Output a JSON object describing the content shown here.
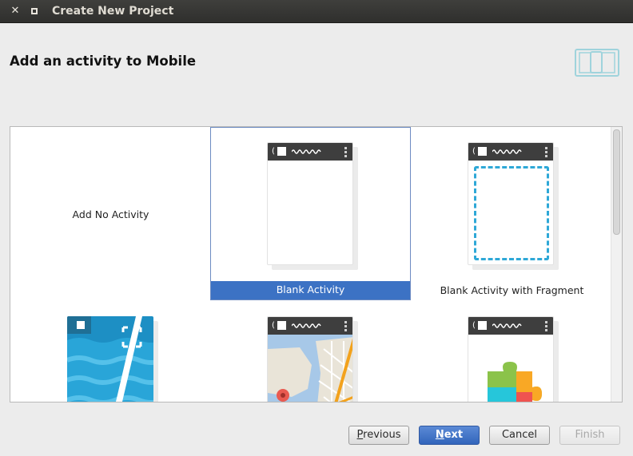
{
  "window": {
    "title": "Create New Project",
    "close_glyph": "✕",
    "maximize_icon": "maximize-icon"
  },
  "header": {
    "heading": "Add an activity to Mobile",
    "device_icon": "tablet-phone-icon"
  },
  "gallery": {
    "tiles": [
      {
        "label": "Add No Activity",
        "selected": false,
        "thumbnail": "none"
      },
      {
        "label": "Blank Activity",
        "selected": true,
        "thumbnail": "blank-phone"
      },
      {
        "label": "Blank Activity with Fragment",
        "selected": false,
        "thumbnail": "fragment-phone"
      },
      {
        "label": "",
        "selected": false,
        "thumbnail": "fullscreen-phone"
      },
      {
        "label": "",
        "selected": false,
        "thumbnail": "maps-phone"
      },
      {
        "label": "",
        "selected": false,
        "thumbnail": "play-services-phone"
      }
    ]
  },
  "buttons": {
    "previous": {
      "mnemonic": "P",
      "rest": "revious"
    },
    "next": {
      "mnemonic": "N",
      "rest": "ext"
    },
    "cancel": "Cancel",
    "finish": "Finish"
  },
  "colors": {
    "selection": "#3c72c4",
    "accent_dashed": "#2ea8d7",
    "device_icon": "#9fd3dc"
  }
}
